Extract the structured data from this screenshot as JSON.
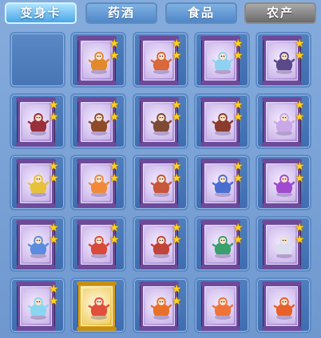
{
  "tabs": [
    {
      "label": "变身卡",
      "state": "active"
    },
    {
      "label": "药酒",
      "state": "normal"
    },
    {
      "label": "食品",
      "state": "normal"
    },
    {
      "label": "农产",
      "state": "disabled"
    }
  ],
  "grid": [
    {
      "empty": true
    },
    {
      "icon": "lion-dancer-icon",
      "stars": 2,
      "frame": "purple",
      "glow": false,
      "hue": "#e08a2c"
    },
    {
      "icon": "fox-warrior-icon",
      "stars": 2,
      "frame": "purple",
      "glow": false,
      "hue": "#d9683a"
    },
    {
      "icon": "white-rabbit-icon",
      "stars": 2,
      "frame": "purple",
      "glow": false,
      "hue": "#8fd2f0"
    },
    {
      "icon": "dark-swordsman-icon",
      "stars": 2,
      "frame": "purple",
      "glow": false,
      "hue": "#5a4a8a"
    },
    {
      "icon": "demon-general-icon",
      "stars": 2,
      "frame": "purple",
      "glow": true,
      "hue": "#9a2f3c"
    },
    {
      "icon": "rider-on-beast-icon",
      "stars": 2,
      "frame": "purple",
      "glow": true,
      "hue": "#8e4b2a"
    },
    {
      "icon": "rider-on-beast-icon",
      "stars": 2,
      "frame": "purple",
      "glow": true,
      "hue": "#7e4a35"
    },
    {
      "icon": "rider-on-beast-icon",
      "stars": 2,
      "frame": "purple",
      "glow": true,
      "hue": "#8a3d2e"
    },
    {
      "icon": "mage-warrior-icon",
      "stars": 2,
      "frame": "purple",
      "glow": true,
      "hue": "#c9a8e8"
    },
    {
      "icon": "golden-dragon-icon",
      "stars": 2,
      "frame": "purple",
      "glow": true,
      "hue": "#e6c23a"
    },
    {
      "icon": "phoenix-girl-icon",
      "stars": 2,
      "frame": "purple",
      "glow": true,
      "hue": "#f08a3a"
    },
    {
      "icon": "winged-lizard-icon",
      "stars": 2,
      "frame": "purple",
      "glow": true,
      "hue": "#c7563b"
    },
    {
      "icon": "blue-serpent-icon",
      "stars": 2,
      "frame": "purple",
      "glow": true,
      "hue": "#4a6ed0"
    },
    {
      "icon": "purple-bird-icon",
      "stars": 2,
      "frame": "purple",
      "glow": true,
      "hue": "#a04ad0"
    },
    {
      "icon": "blue-dragon-icon",
      "stars": 2,
      "frame": "purple",
      "glow": true,
      "hue": "#5a8ce0"
    },
    {
      "icon": "red-ape-icon",
      "stars": 2,
      "frame": "purple",
      "glow": false,
      "hue": "#d94a3a"
    },
    {
      "icon": "red-ape-rider-icon",
      "stars": 2,
      "frame": "purple",
      "glow": false,
      "hue": "#c0443a"
    },
    {
      "icon": "jade-dragon-icon",
      "stars": 2,
      "frame": "purple",
      "glow": false,
      "hue": "#3aa06e"
    },
    {
      "icon": "silver-knight-icon",
      "stars": 2,
      "frame": "purple",
      "glow": false,
      "hue": "#dcdcf0"
    },
    {
      "icon": "ice-qilin-icon",
      "stars": 2,
      "frame": "purple",
      "glow": false,
      "hue": "#8ad6f0"
    },
    {
      "icon": "fire-fairy-icon",
      "stars": 0,
      "frame": "gold",
      "glow": false,
      "hue": "#e0503a"
    },
    {
      "icon": "flame-warrior-icon",
      "stars": 2,
      "frame": "purple",
      "glow": true,
      "hue": "#e8702a"
    },
    {
      "icon": "fire-phoenix-icon",
      "stars": 0,
      "frame": "purple",
      "glow": false,
      "hue": "#f0743a"
    },
    {
      "icon": "fire-phoenix-icon",
      "stars": 0,
      "frame": "purple",
      "glow": false,
      "hue": "#e8602a"
    }
  ]
}
